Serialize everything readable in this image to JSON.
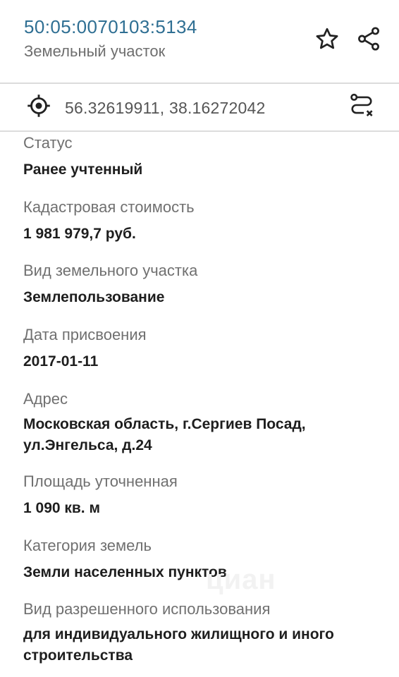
{
  "header": {
    "cadastral_number": "50:05:0070103:5134",
    "object_type": "Земельный участок",
    "star_icon": "star-outline-icon",
    "share_icon": "share-icon"
  },
  "coords_bar": {
    "coordinates": "56.32619911, 38.16272042",
    "target_icon": "crosshair-icon",
    "route_icon": "route-icon"
  },
  "fields": [
    {
      "label": "Статус",
      "value": "Ранее учтенный"
    },
    {
      "label": "Кадастровая стоимость",
      "value": "1 981 979,7 руб."
    },
    {
      "label": "Вид земельного участка",
      "value": "Землепользование"
    },
    {
      "label": "Дата присвоения",
      "value": "2017-01-11"
    },
    {
      "label": "Адрес",
      "value": "Московская область, г.Сергиев Посад, ул.Энгельса, д.24"
    },
    {
      "label": "Площадь уточненная",
      "value": "1 090 кв. м"
    },
    {
      "label": "Категория земель",
      "value": "Земли населенных пунктов"
    },
    {
      "label": "Вид разрешенного использования",
      "value": "для индивидуального жилищного и иного строительства"
    }
  ],
  "watermark": "циан",
  "colors": {
    "accent": "#2f6f93",
    "label": "#707070",
    "value": "#1e1e1e",
    "divider": "#dcdcdc"
  }
}
